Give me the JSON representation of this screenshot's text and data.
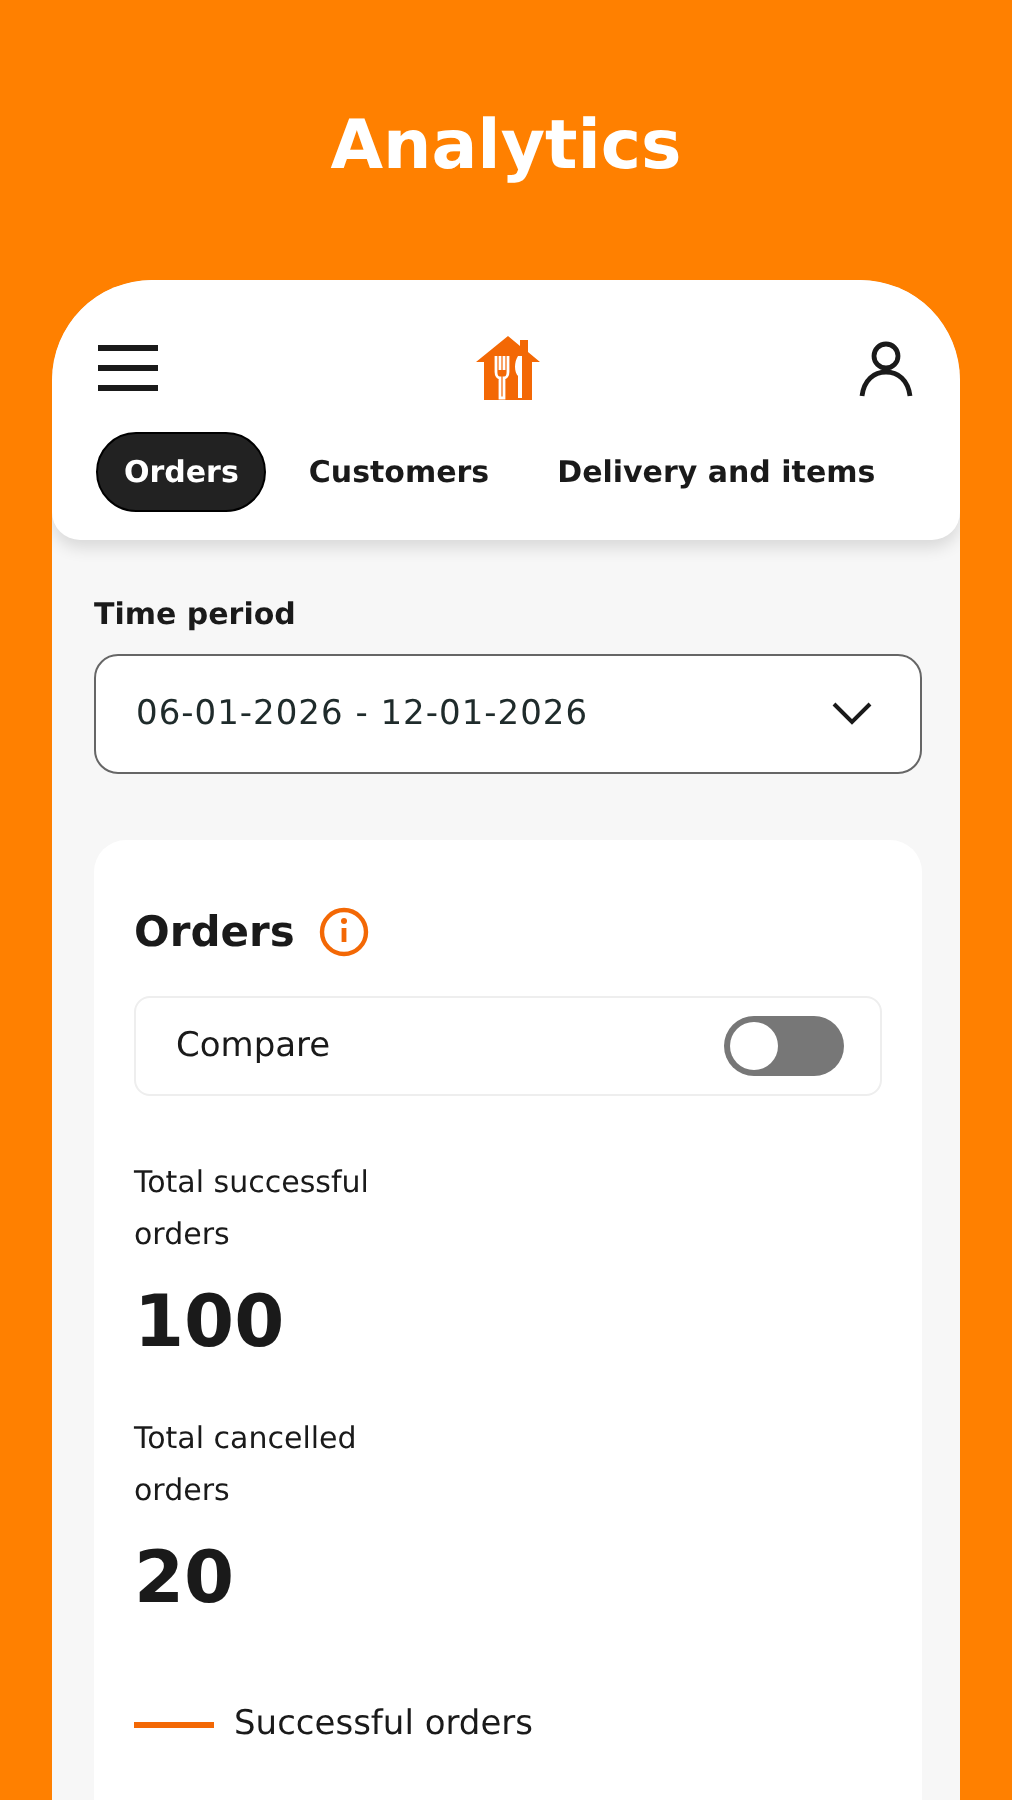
{
  "page_title": "Analytics",
  "tabs": [
    {
      "label": "Orders",
      "selected": true
    },
    {
      "label": "Customers",
      "selected": false
    },
    {
      "label": "Delivery and items",
      "selected": false
    }
  ],
  "time_period": {
    "label": "Time period",
    "value": "06-01-2026 - 12-01-2026"
  },
  "orders_card": {
    "title": "Orders",
    "compare": {
      "label": "Compare",
      "on": false
    },
    "stats": [
      {
        "label": "Total successful orders",
        "value": "100"
      },
      {
        "label": "Total cancelled orders",
        "value": "20"
      }
    ],
    "legend": [
      {
        "label": "Successful orders",
        "color": "#f36805"
      }
    ]
  }
}
